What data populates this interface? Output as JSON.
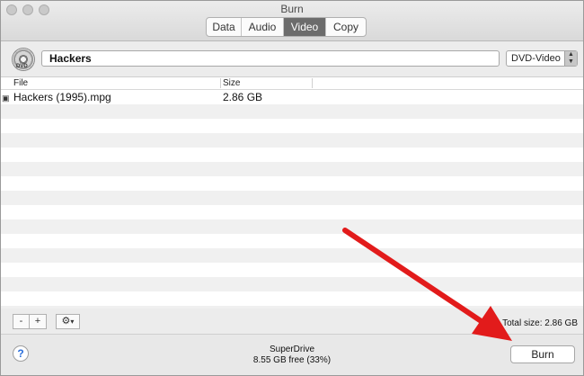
{
  "window": {
    "title": "Burn"
  },
  "tabs": [
    {
      "label": "Data",
      "active": false
    },
    {
      "label": "Audio",
      "active": false
    },
    {
      "label": "Video",
      "active": true
    },
    {
      "label": "Copy",
      "active": false
    }
  ],
  "disc": {
    "icon": "dvd-disc-icon",
    "badge": "DVD"
  },
  "name_field": {
    "value": "Hackers"
  },
  "format_select": {
    "selected": "DVD-Video"
  },
  "table": {
    "columns": [
      "File",
      "Size"
    ],
    "rows": [
      {
        "file": "Hackers (1995).mpg",
        "size": "2.86 GB",
        "icon": "video-file-icon"
      }
    ]
  },
  "toolbar": {
    "remove_label": "-",
    "add_label": "+",
    "settings_icon": "gear-icon",
    "settings_arrow": "▾",
    "total_size": "Total size: 2.86 GB"
  },
  "footer": {
    "help_label": "?",
    "drive_name": "SuperDrive",
    "drive_free": "8.55 GB free (33%)",
    "burn_label": "Burn"
  },
  "annotation": {
    "arrow_color": "#e21b1b"
  }
}
